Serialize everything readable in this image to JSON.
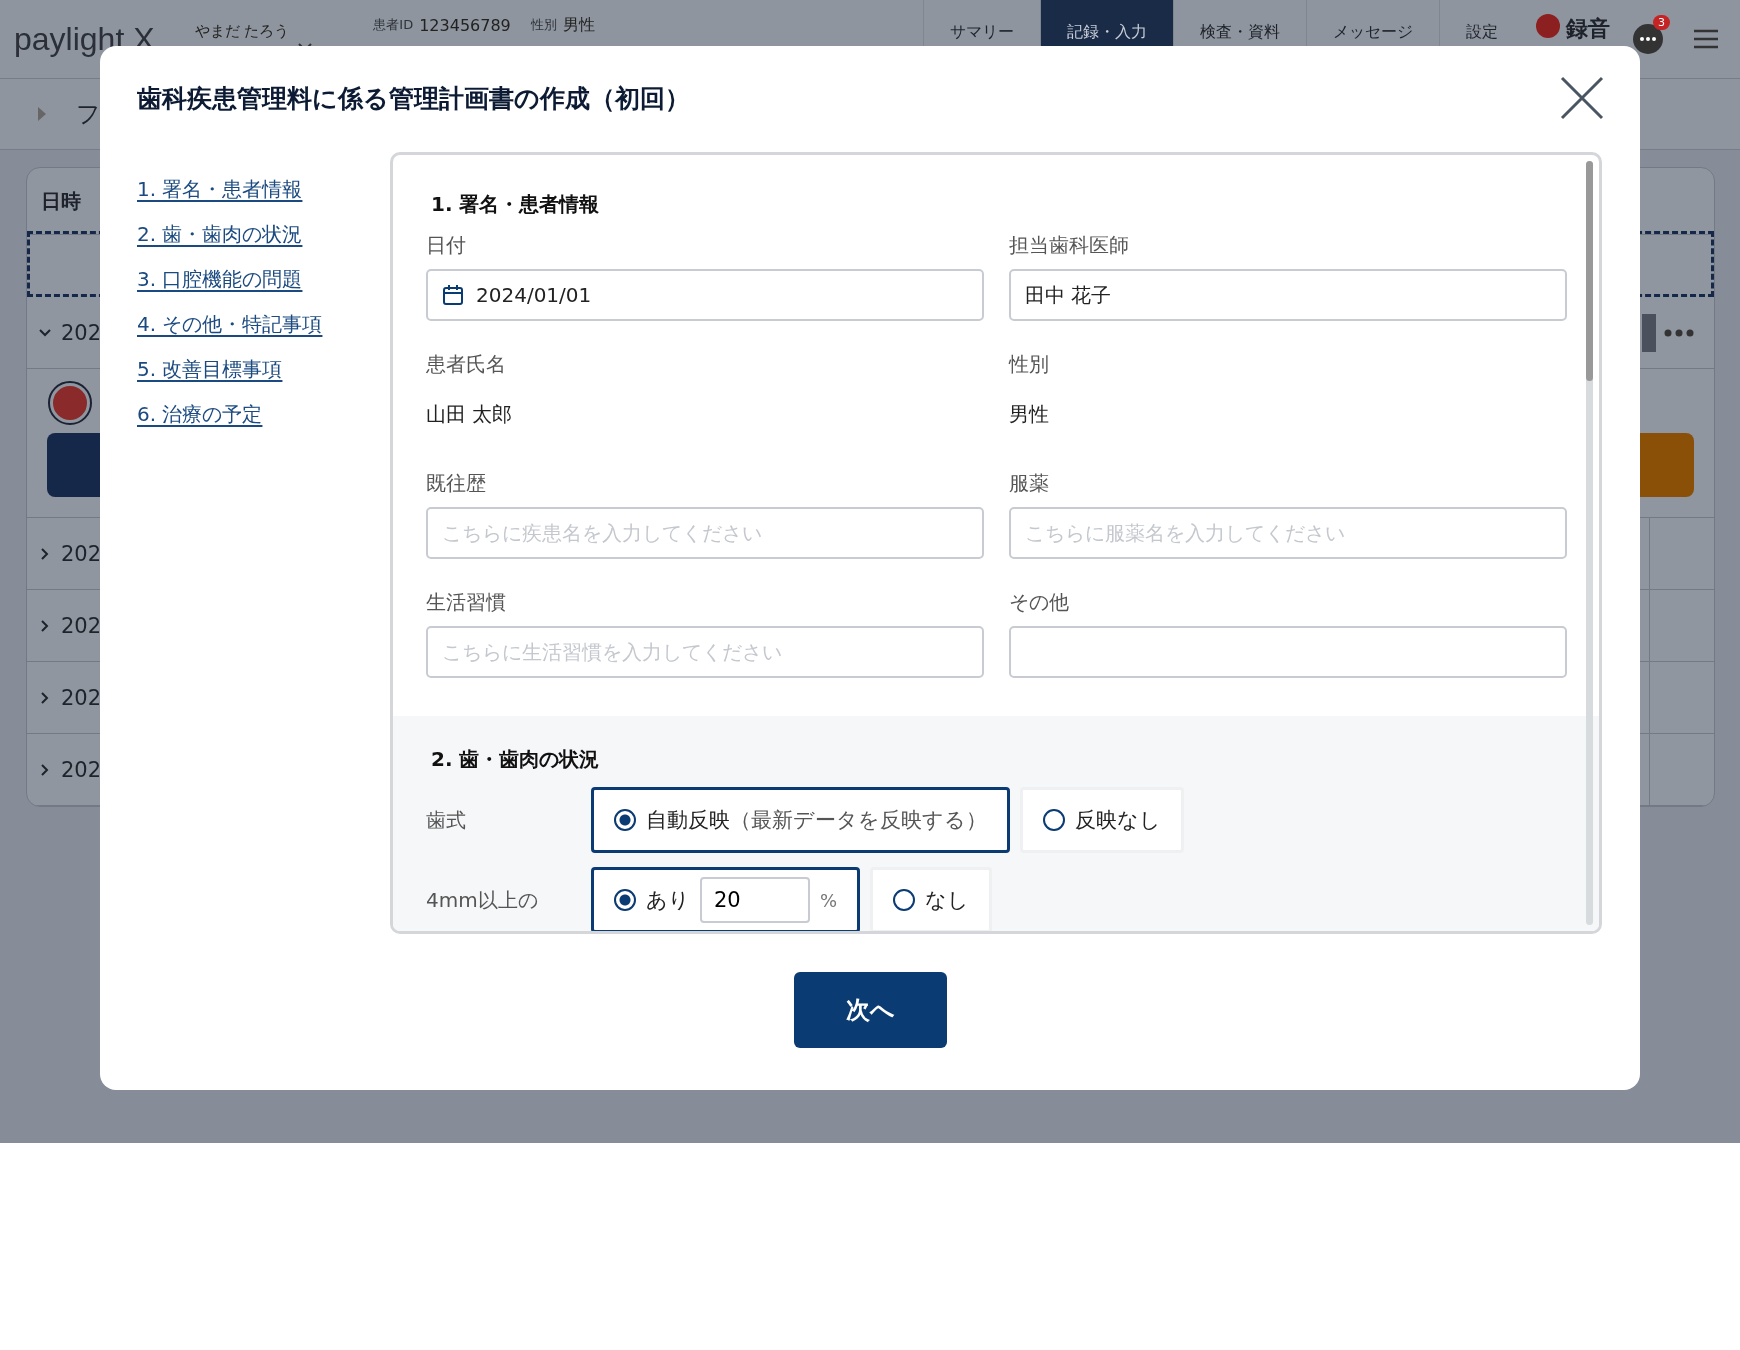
{
  "app_header": {
    "logo": "paylight X",
    "patient_kana": "やまだ たろう",
    "id_label": "患者ID",
    "id_value": "123456789",
    "sex_label": "性別",
    "sex_value": "男性",
    "nav": [
      {
        "label": "サマリー",
        "selected": false
      },
      {
        "label": "記録・入力",
        "selected": true
      },
      {
        "label": "検査・資料",
        "selected": false
      },
      {
        "label": "メッセージ",
        "selected": false
      },
      {
        "label": "設定",
        "selected": false
      }
    ],
    "record_label": "録音",
    "notification_count": "3"
  },
  "subheader": {
    "title": "フ"
  },
  "table": {
    "columns": [
      "日時"
    ],
    "rows": [
      {
        "date": "202",
        "expanded": true
      },
      {
        "date": "202",
        "expanded": false
      },
      {
        "date": "202",
        "expanded": false
      },
      {
        "date": "202",
        "expanded": false
      },
      {
        "date": "202",
        "expanded": false
      }
    ]
  },
  "modal": {
    "title": "歯科疾患管理料に係る管理計画書の作成（初回）",
    "toc": [
      "1. 署名・患者情報",
      "2. 歯・歯肉の状況",
      "3. 口腔機能の問題",
      "4. その他・特記事項",
      "5. 改善目標事項",
      "6. 治療の予定"
    ],
    "section1": {
      "title": "1. 署名・患者情報",
      "fields": [
        {
          "kind": "date",
          "label": "日付",
          "value": "2024/01/01"
        },
        {
          "kind": "input",
          "label": "担当歯科医師",
          "value": "田中 花子"
        },
        {
          "kind": "text",
          "label": "患者氏名",
          "value": "山田 太郎"
        },
        {
          "kind": "text",
          "label": "性別",
          "value": "男性"
        },
        {
          "kind": "input",
          "label": "既往歴",
          "placeholder": "こちらに疾患名を入力してください"
        },
        {
          "kind": "input",
          "label": "服薬",
          "placeholder": "こちらに服薬名を入力してください"
        },
        {
          "kind": "input",
          "label": "生活習慣",
          "placeholder": "こちらに生活習慣を入力してください"
        },
        {
          "kind": "input",
          "label": "その他"
        }
      ]
    },
    "section2": {
      "title": "2. 歯・歯肉の状況",
      "rows": [
        {
          "label": "歯式",
          "options": [
            {
              "label": "自動反映",
              "note": "（最新データを反映する）",
              "selected": true
            },
            {
              "label": "反映なし",
              "selected": false
            }
          ]
        },
        {
          "label": "4mm以上の",
          "options": [
            {
              "label": "あり",
              "value": "20",
              "unit": "%",
              "selected": true
            },
            {
              "label": "なし",
              "selected": false
            }
          ]
        }
      ]
    },
    "next_button": "次へ"
  }
}
